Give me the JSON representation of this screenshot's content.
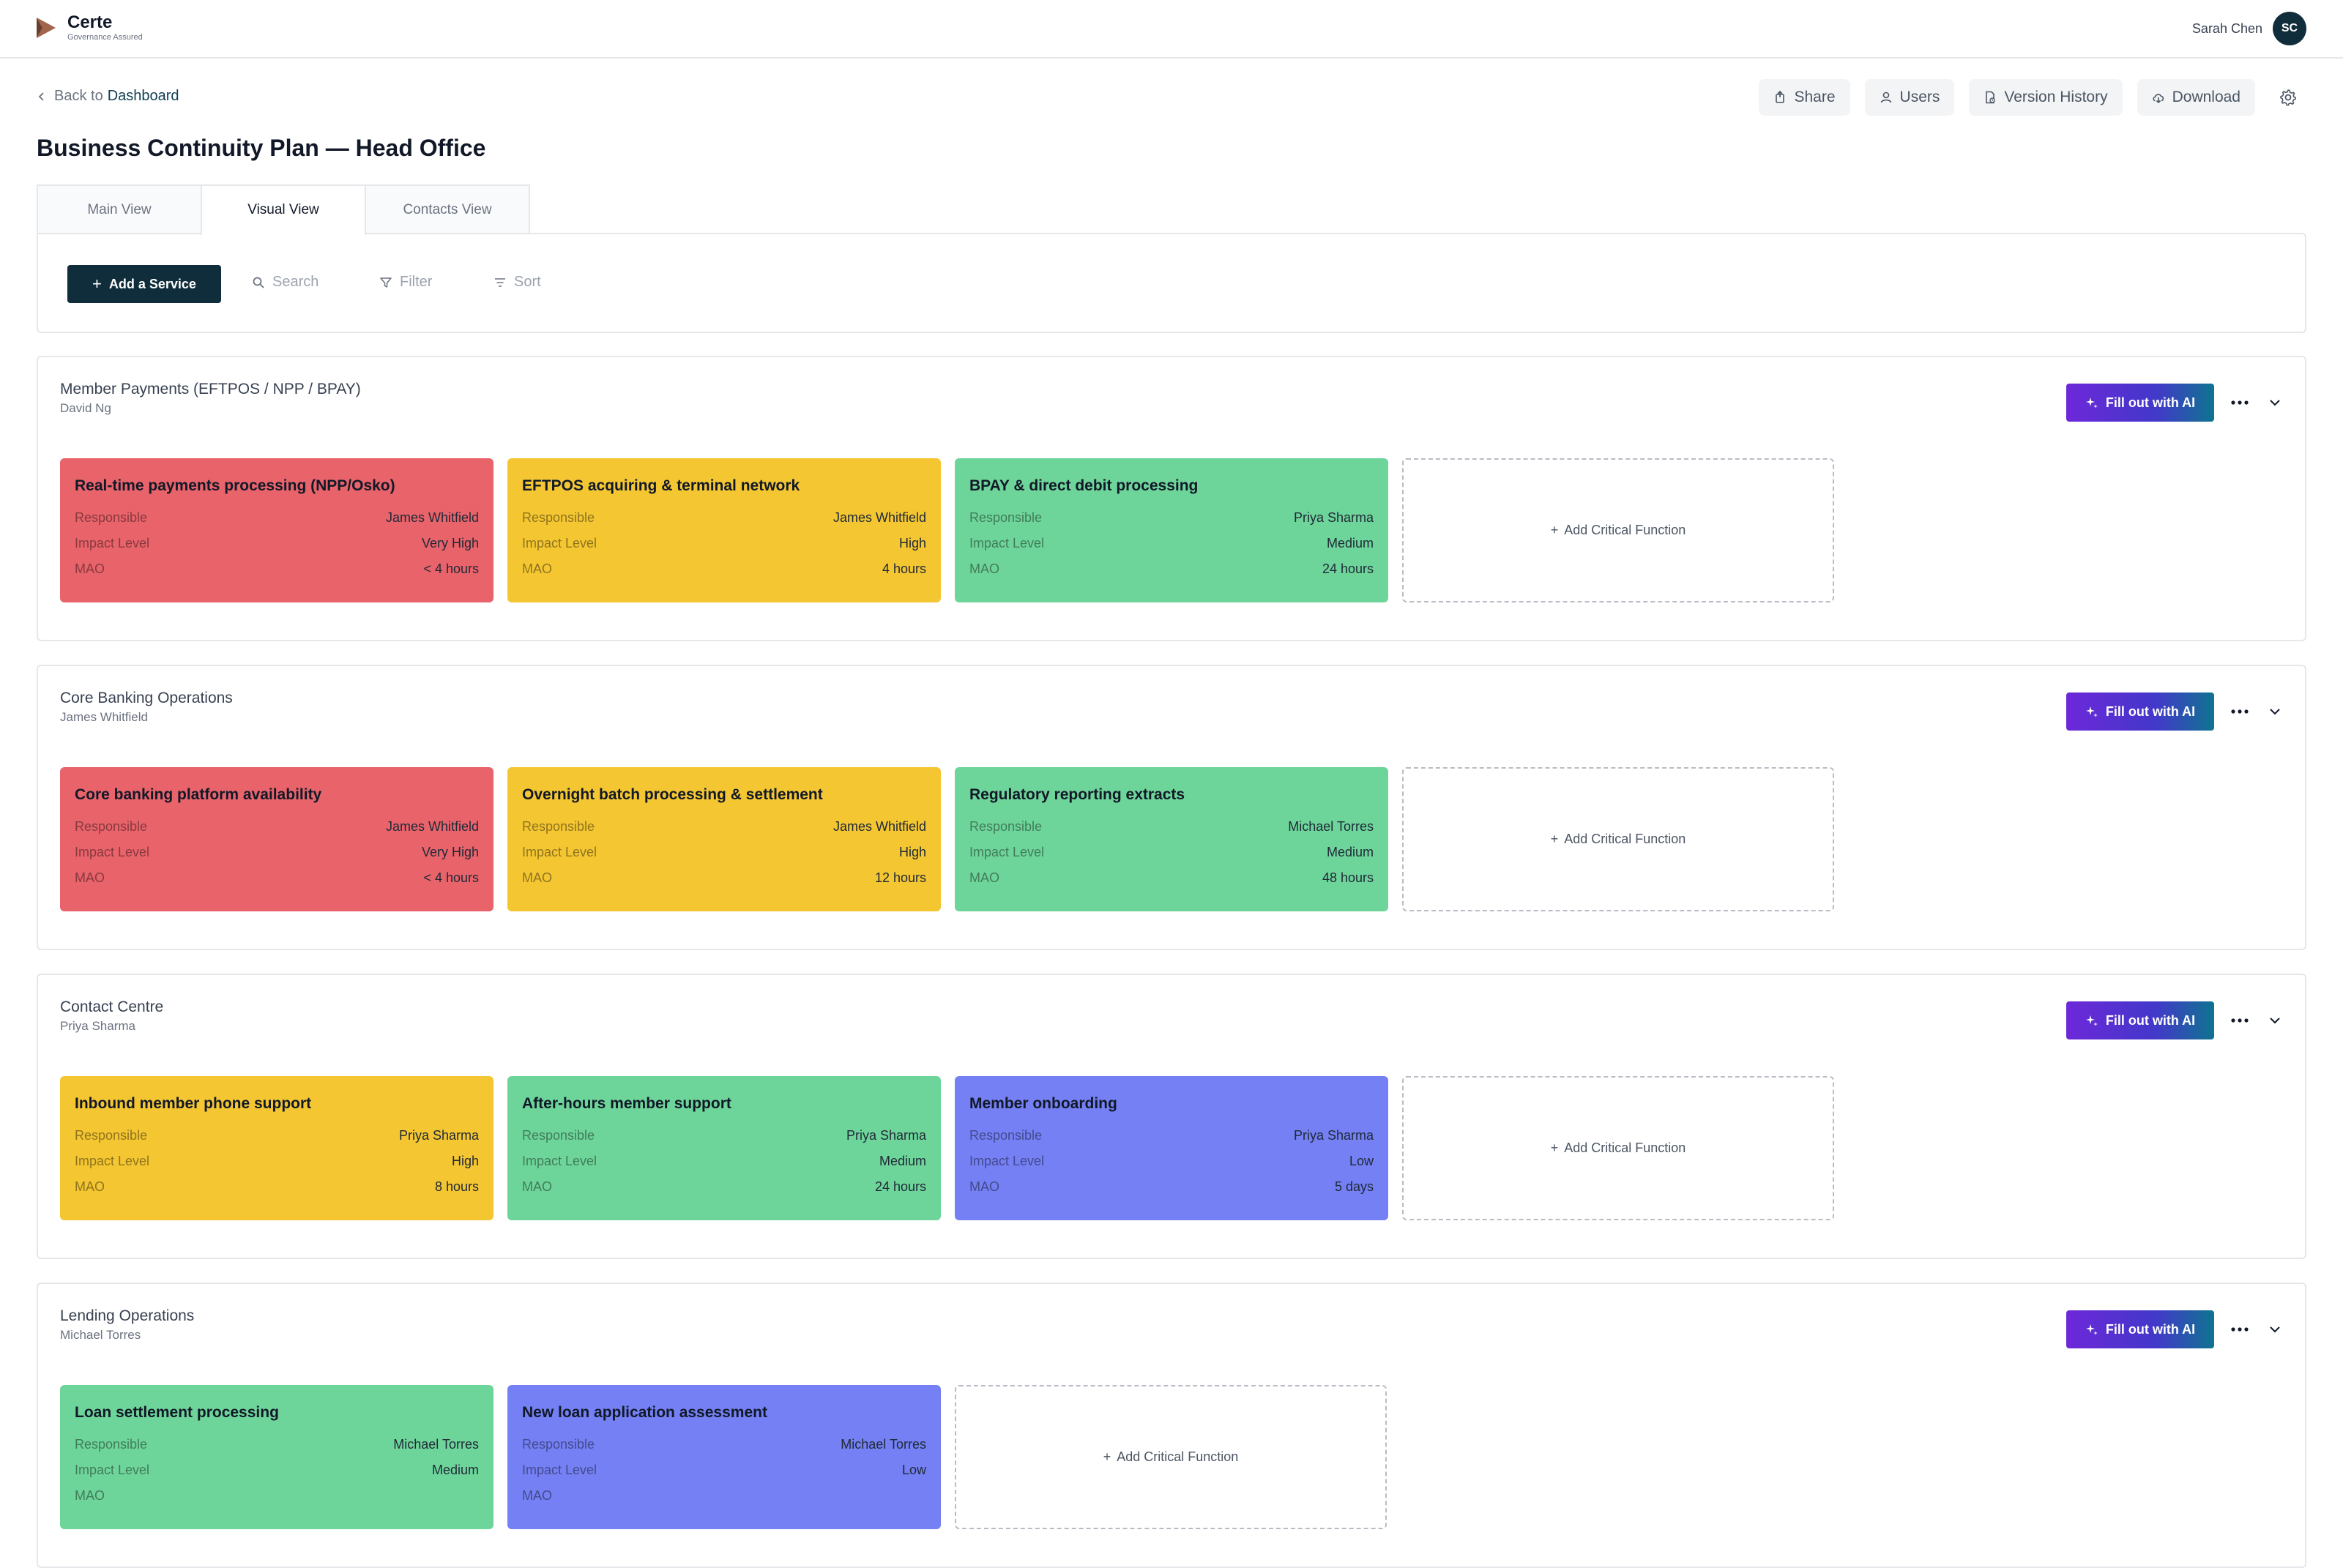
{
  "app": {
    "brand_name": "Certe",
    "brand_tagline": "Governance Assured",
    "user_name": "Sarah Chen",
    "user_initials": "SC"
  },
  "header": {
    "back_prefix": "Back to",
    "back_link": "Dashboard",
    "title": "Business Continuity Plan — Head Office",
    "actions": {
      "share": "Share",
      "users": "Users",
      "version_history": "Version History",
      "download": "Download"
    }
  },
  "tabs": [
    {
      "label": "Main View"
    },
    {
      "label": "Visual View",
      "active": true
    },
    {
      "label": "Contacts View"
    }
  ],
  "toolbar": {
    "add_service": "Add a Service",
    "search": "Search",
    "filter": "Filter",
    "sort": "Sort"
  },
  "labels": {
    "responsible": "Responsible",
    "impact_level": "Impact Level",
    "mao": "MAO",
    "fill_ai": "Fill out with AI",
    "add_critical_function": "Add Critical Function"
  },
  "colors": {
    "very_high": "#e9636b",
    "high": "#f4c632",
    "medium": "#6ed59a",
    "low": "#7480f3",
    "primary": "#0f2d3a"
  },
  "services": [
    {
      "name": "Member Payments (EFTPOS / NPP / BPAY)",
      "owner": "David Ng",
      "functions": [
        {
          "title": "Real-time payments processing (NPP/Osko)",
          "responsible": "James Whitfield",
          "impact": "Very High",
          "mao": "< 4 hours"
        },
        {
          "title": "EFTPOS acquiring & terminal network",
          "responsible": "James Whitfield",
          "impact": "High",
          "mao": "4 hours"
        },
        {
          "title": "BPAY & direct debit processing",
          "responsible": "Priya Sharma",
          "impact": "Medium",
          "mao": "24 hours"
        }
      ]
    },
    {
      "name": "Core Banking Operations",
      "owner": "James Whitfield",
      "functions": [
        {
          "title": "Core banking platform availability",
          "responsible": "James Whitfield",
          "impact": "Very High",
          "mao": "< 4 hours"
        },
        {
          "title": "Overnight batch processing & settlement",
          "responsible": "James Whitfield",
          "impact": "High",
          "mao": "12 hours"
        },
        {
          "title": "Regulatory reporting extracts",
          "responsible": "Michael Torres",
          "impact": "Medium",
          "mao": "48 hours"
        }
      ]
    },
    {
      "name": "Contact Centre",
      "owner": "Priya Sharma",
      "functions": [
        {
          "title": "Inbound member phone support",
          "responsible": "Priya Sharma",
          "impact": "High",
          "mao": "8 hours"
        },
        {
          "title": "After-hours member support",
          "responsible": "Priya Sharma",
          "impact": "Medium",
          "mao": "24 hours"
        },
        {
          "title": "Member onboarding",
          "responsible": "Priya Sharma",
          "impact": "Low",
          "mao": "5 days"
        }
      ]
    },
    {
      "name": "Lending Operations",
      "owner": "Michael Torres",
      "functions": [
        {
          "title": "Loan settlement processing",
          "responsible": "Michael Torres",
          "impact": "Medium",
          "mao": ""
        },
        {
          "title": "New loan application assessment",
          "responsible": "Michael Torres",
          "impact": "Low",
          "mao": ""
        }
      ]
    }
  ]
}
